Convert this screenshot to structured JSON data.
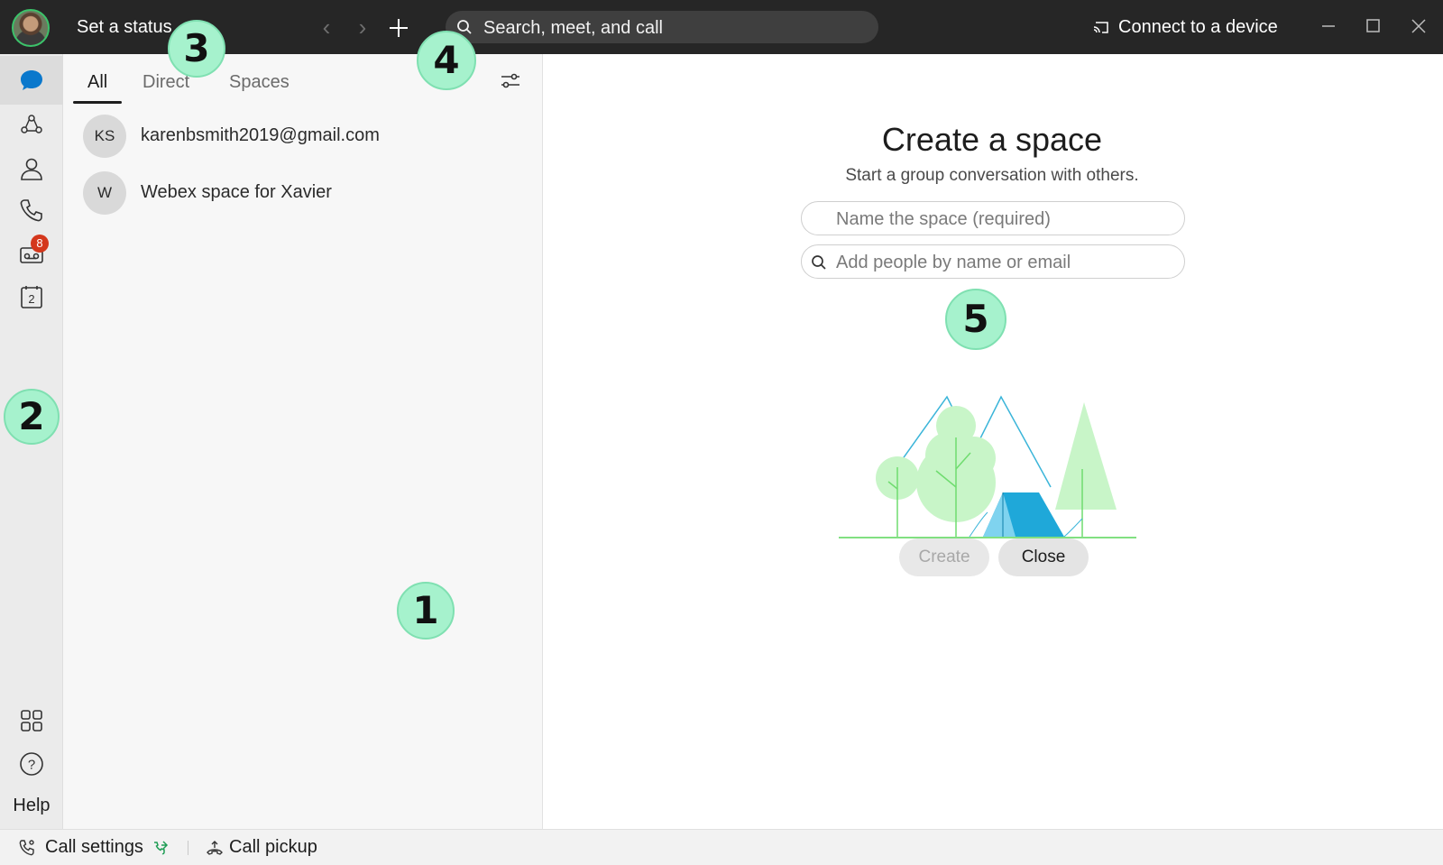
{
  "titlebar": {
    "status": "Set a status",
    "search_placeholder": "Search, meet, and call",
    "connect_label": "Connect to a device"
  },
  "rail": {
    "items": [
      {
        "name": "messaging",
        "icon": "chat-bubble-icon",
        "active": true
      },
      {
        "name": "teams",
        "icon": "teams-icon"
      },
      {
        "name": "contacts",
        "icon": "person-icon"
      },
      {
        "name": "calling",
        "icon": "phone-icon"
      },
      {
        "name": "voicemail",
        "icon": "voicemail-icon",
        "badge": "8"
      },
      {
        "name": "meetings",
        "icon": "calendar-icon",
        "calendar_day": "2"
      }
    ],
    "help_label": "Help"
  },
  "list": {
    "tabs": [
      "All",
      "Direct",
      "Spaces"
    ],
    "active_tab": "All",
    "items": [
      {
        "initials": "KS",
        "name": "karenbsmith2019@gmail.com"
      },
      {
        "initials": "W",
        "name": "Webex space for Xavier"
      }
    ]
  },
  "create_space": {
    "title": "Create a space",
    "subtitle": "Start a group conversation with others.",
    "name_placeholder": "Name the space (required)",
    "people_placeholder": "Add people by name or email",
    "create_label": "Create",
    "close_label": "Close"
  },
  "callouts": [
    "1",
    "2",
    "3",
    "4",
    "5"
  ],
  "bottombar": {
    "call_settings": "Call settings",
    "call_pickup": "Call pickup"
  },
  "colors": {
    "titlebar": "#262626",
    "accent_blue": "#0a78cc",
    "badge": "#d4371c",
    "callout": "#a6f2cd",
    "illustration_green": "#c8f5c8",
    "tent_blue": "#1fa8d9"
  }
}
